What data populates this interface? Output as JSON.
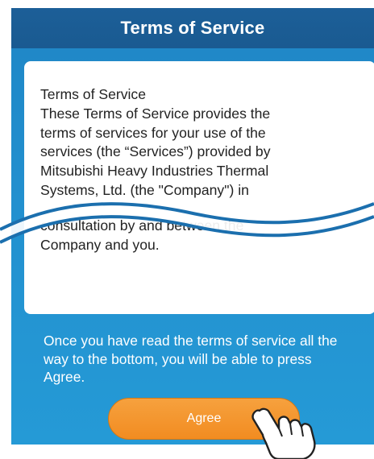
{
  "header": {
    "title": "Terms of Service"
  },
  "terms": {
    "lines_top": [
      "Terms of Service",
      "These Terms of Service provides the",
      "terms of services for your use of the",
      "services (the “Services”) provided by",
      "Mitsubishi Heavy Industries Thermal",
      "Systems, Ltd. (the \"Company\") in"
    ],
    "lines_bottom": [
      "consultation by and between the",
      "Company and you."
    ]
  },
  "notice": {
    "text": "Once you have read the terms of service all the way to the bottom, you will be able to press Agree."
  },
  "agree_button": {
    "label": "Agree"
  },
  "colors": {
    "header": "#1a5a91",
    "background": "#2290cf",
    "button": "#f28c21"
  },
  "icons": {
    "pointer": "pointing-hand-icon",
    "break": "wave-break-icon"
  }
}
